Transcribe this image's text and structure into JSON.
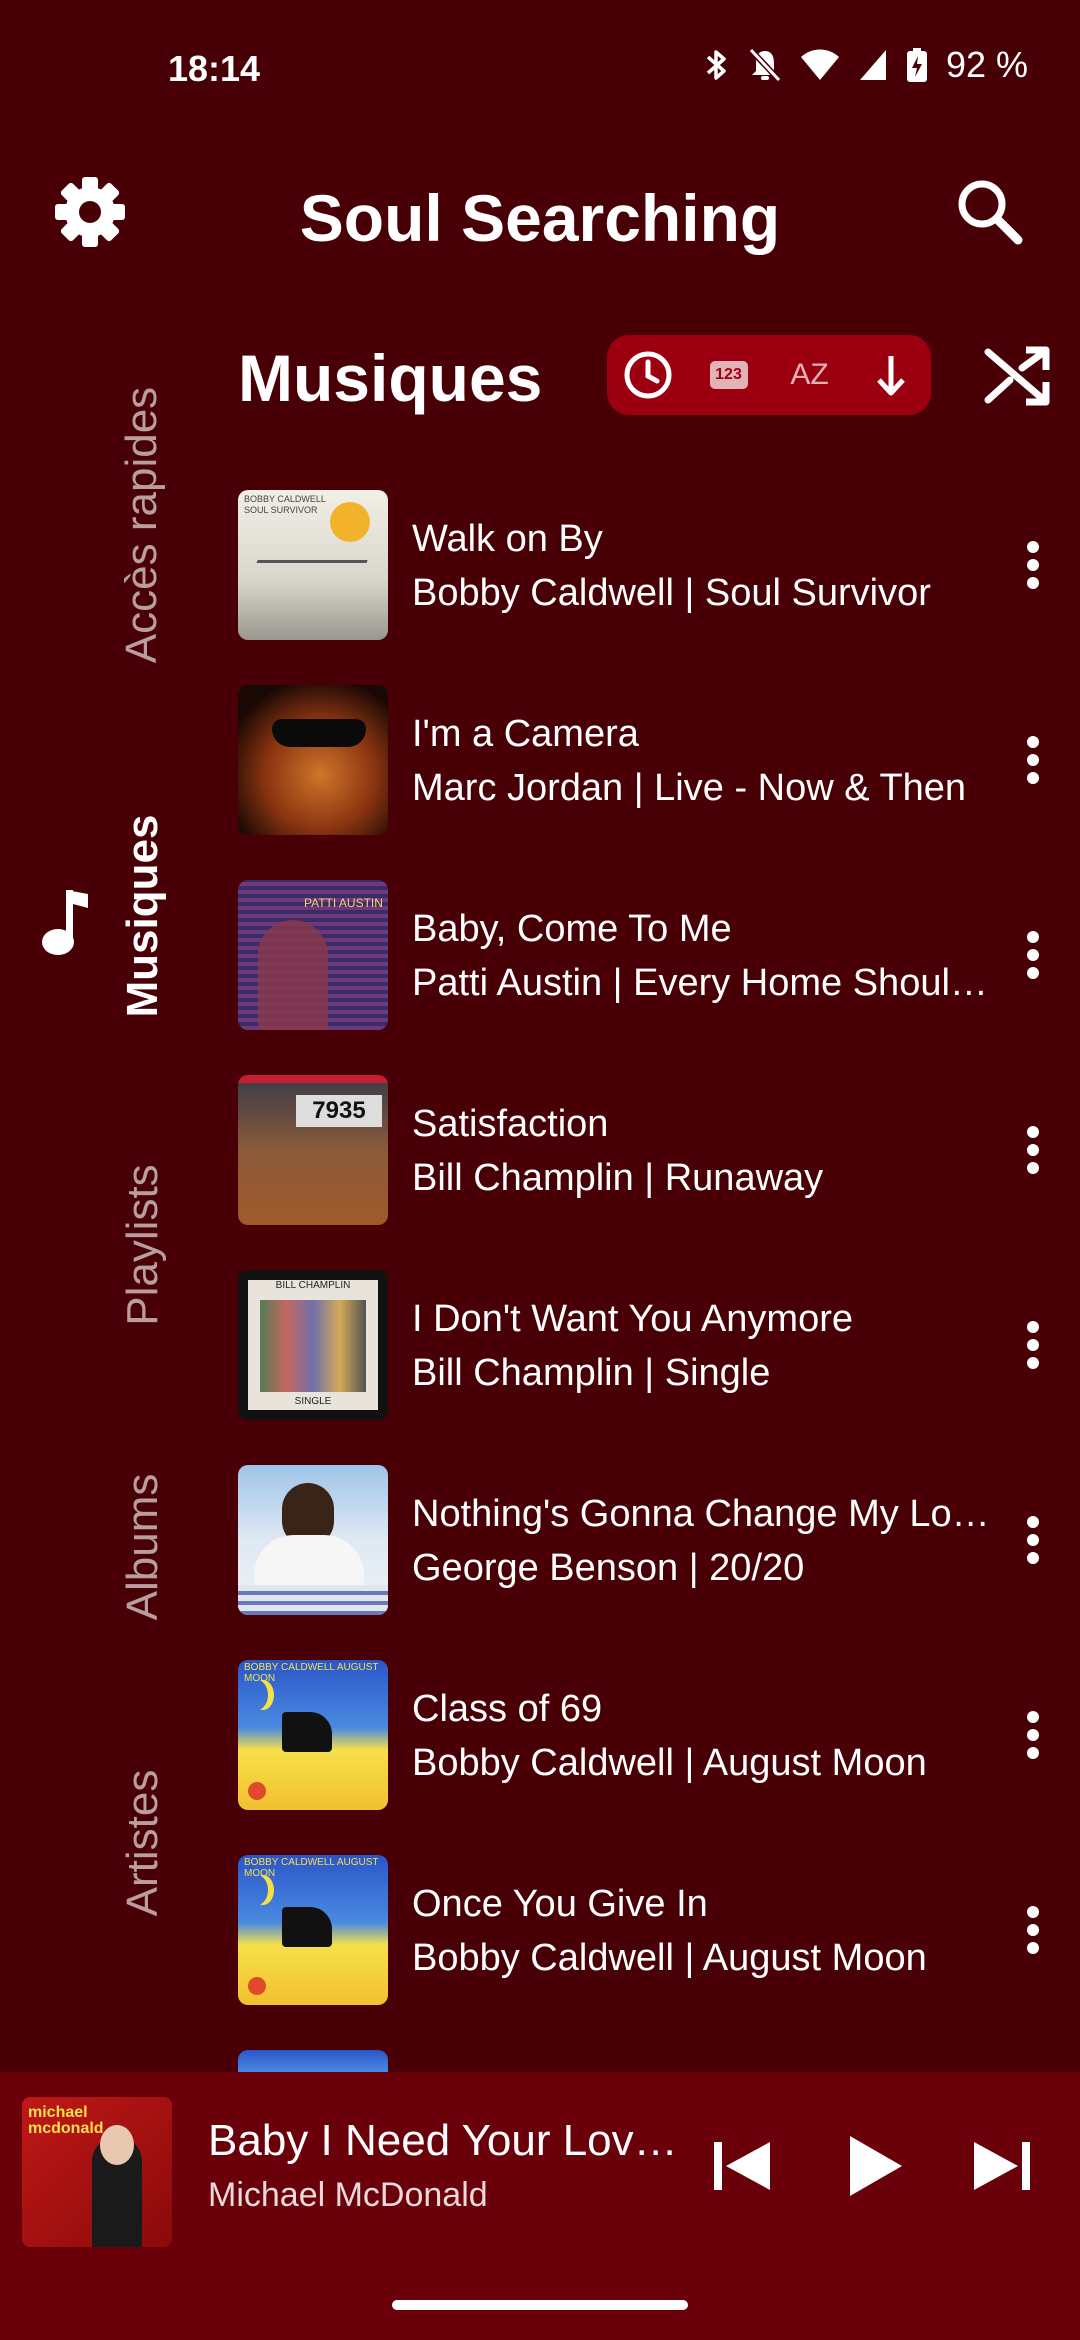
{
  "status": {
    "time": "18:14",
    "battery": "92 %"
  },
  "header": {
    "title": "Soul Searching"
  },
  "side_nav": {
    "tabs": [
      "Accès rapides",
      "Musiques",
      "Playlists",
      "Albums",
      "Artistes"
    ],
    "active": "Musiques"
  },
  "section": {
    "title": "Musiques"
  },
  "sort_bar": {
    "icons": [
      "clock-icon",
      "number-sort-icon",
      "alpha-sort-icon",
      "arrow-down-icon"
    ],
    "number_label": "123",
    "alpha_label": "AZ"
  },
  "tracks": [
    {
      "title": "Walk on By",
      "subtitle": "Bobby Caldwell | Soul Survivor"
    },
    {
      "title": "I'm a Camera",
      "subtitle": "Marc Jordan | Live - Now & Then"
    },
    {
      "title": "Baby, Come To Me",
      "subtitle": "Patti Austin | Every Home Should Have One"
    },
    {
      "title": "Satisfaction",
      "subtitle": "Bill Champlin | Runaway"
    },
    {
      "title": "I Don't Want You Anymore",
      "subtitle": "Bill Champlin | Single"
    },
    {
      "title": "Nothing's Gonna Change My Love For You",
      "subtitle": "George Benson | 20/20"
    },
    {
      "title": "Class of 69",
      "subtitle": "Bobby Caldwell | August Moon"
    },
    {
      "title": "Once You Give In",
      "subtitle": "Bobby Caldwell | August Moon"
    }
  ],
  "cover_art": {
    "soul_survivor_text": "BOBBY CALDWELL SOUL SURVIVOR",
    "champlin_text": "BILL CHAMPLIN",
    "champlin_single": "SINGLE",
    "runaway_plate": "7935",
    "august_moon_text": "BOBBY CALDWELL AUGUST MOON",
    "patti_text": "PATTI AUSTIN",
    "mcdonald_text": "michael mcdonald"
  },
  "now_playing": {
    "title": "Baby I Need Your Loving",
    "artist": "Michael McDonald"
  },
  "colors": {
    "background": "#480006",
    "sort_bar": "#9c0010",
    "mini_player": "#6a0009"
  }
}
